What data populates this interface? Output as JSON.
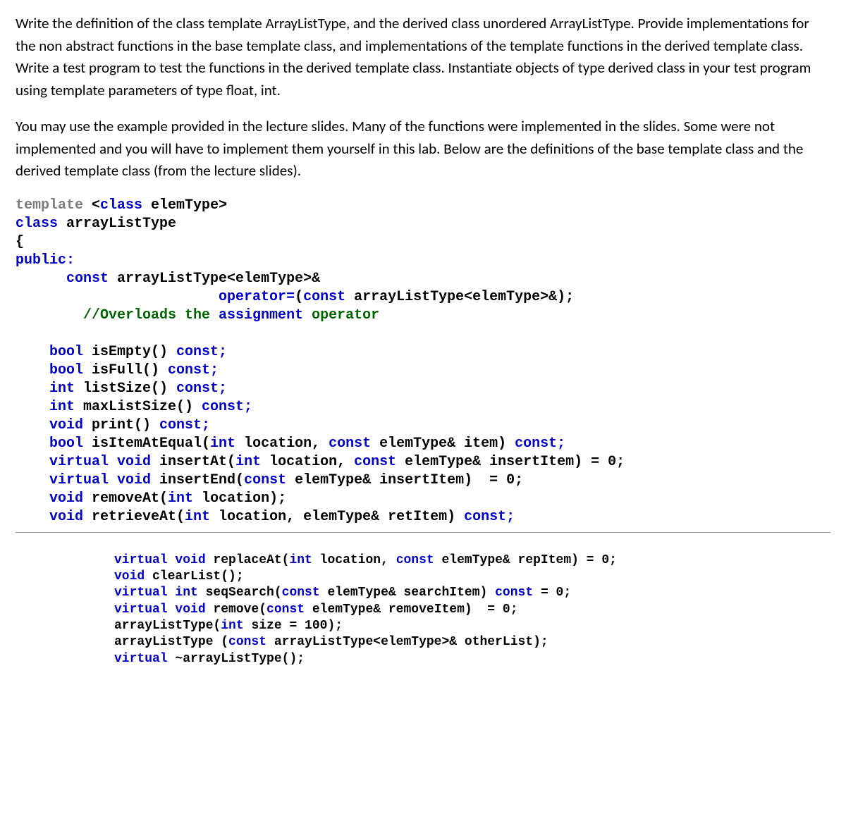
{
  "para1": "Write the definition of the class template ArrayListType, and the derived class unordered ArrayListType.  Provide implementations for the non abstract functions in the base template class, and implementations of the template functions in the derived template class.  Write a test program to test the functions in the derived template class.  Instantiate objects of type derived class in your test program using template parameters of type float, int.",
  "para2": "You may use the example provided in the lecture slides.  Many of the functions were implemented in the slides.  Some were not implemented and you will have to implement them yourself in this lab.  Below are the definitions of the base template class and the derived template class (from the lecture slides).",
  "code1": {
    "l1_a": "template",
    "l1_b": " <",
    "l1_c": "class",
    "l1_d": " elemType>",
    "l2_a": "class",
    "l2_b": " arrayListType",
    "l3": "{",
    "l4": "public:",
    "l5_a": "      const",
    "l5_b": " arrayListType<elemType>&",
    "l6_a": "                        ",
    "l6_b": "operator=",
    "l6_c": "(",
    "l6_d": "const",
    "l6_e": " arrayListType<elemType>&);",
    "l7_a": "        ",
    "l7_b": "//Overloads the ",
    "l7_c": "assignment",
    "l7_d": " operator",
    "l8_a": "    bool",
    "l8_b": " isEmpty() ",
    "l8_c": "const;",
    "l9_a": "    bool",
    "l9_b": " isFull() ",
    "l9_c": "const;",
    "l10_a": "    int",
    "l10_b": " listSize() ",
    "l10_c": "const;",
    "l11_a": "    int",
    "l11_b": " maxListSize() ",
    "l11_c": "const;",
    "l12_a": "    void",
    "l12_b": " print() ",
    "l12_c": "const;",
    "l13_a": "    bool",
    "l13_b": " isItemAtEqual(",
    "l13_c": "int",
    "l13_d": " location, ",
    "l13_e": "const",
    "l13_f": " elemType& item) ",
    "l13_g": "const;",
    "l14_a": "    virtual void",
    "l14_b": " insertAt(",
    "l14_c": "int",
    "l14_d": " location, ",
    "l14_e": "const",
    "l14_f": " elemType& insertItem) = 0;",
    "l15_a": "    virtual void",
    "l15_b": " insertEnd(",
    "l15_c": "const",
    "l15_d": " elemType& insertItem)  = 0;",
    "l16_a": "    void",
    "l16_b": " removeAt(",
    "l16_c": "int",
    "l16_d": " location);",
    "l17_a": "    void",
    "l17_b": " retrieveAt(",
    "l17_c": "int",
    "l17_d": " location, elemType& retItem) ",
    "l17_e": "const;"
  },
  "code2": {
    "l1_a": "virtual void",
    "l1_b": " replaceAt(",
    "l1_c": "int",
    "l1_d": " location, ",
    "l1_e": "const",
    "l1_f": " elemType& repItem) = 0;",
    "l2_a": "void",
    "l2_b": " clearList();",
    "l3_a": "virtual int",
    "l3_b": " seqSearch(",
    "l3_c": "const",
    "l3_d": " elemType& searchItem) ",
    "l3_e": "const",
    "l3_f": " = 0;",
    "l4_a": "virtual void",
    "l4_b": " remove(",
    "l4_c": "const",
    "l4_d": " elemType& removeItem)  = 0;",
    "l5_a": "arrayListType(",
    "l5_b": "int",
    "l5_c": " size = 100);",
    "l6_a": "arrayListType (",
    "l6_b": "const",
    "l6_c": " arrayListType<elemType>& otherList);",
    "l7_a": "virtual",
    "l7_b": " ~arrayListType();"
  }
}
